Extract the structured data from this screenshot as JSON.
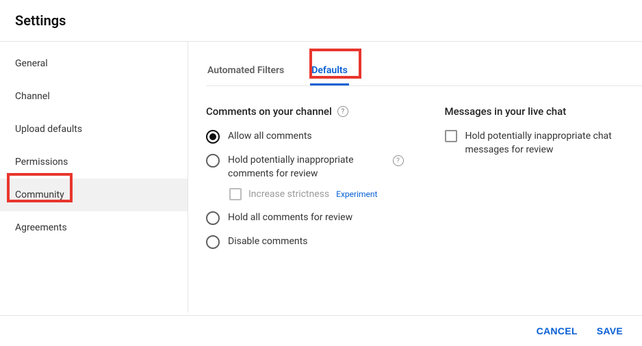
{
  "title": "Settings",
  "sidebar": {
    "items": [
      {
        "label": "General",
        "active": false
      },
      {
        "label": "Channel",
        "active": false
      },
      {
        "label": "Upload defaults",
        "active": false
      },
      {
        "label": "Permissions",
        "active": false
      },
      {
        "label": "Community",
        "active": true
      },
      {
        "label": "Agreements",
        "active": false
      }
    ]
  },
  "tabs": [
    {
      "label": "Automated Filters",
      "active": false
    },
    {
      "label": "Defaults",
      "active": true
    }
  ],
  "comments": {
    "title": "Comments on your channel",
    "options": [
      {
        "label": "Allow all comments",
        "selected": true
      },
      {
        "label": "Hold potentially inappropriate comments for review",
        "selected": false,
        "help": true,
        "sub": {
          "label": "Increase strictness",
          "badge": "Experiment",
          "disabled": true
        }
      },
      {
        "label": "Hold all comments for review",
        "selected": false
      },
      {
        "label": "Disable comments",
        "selected": false
      }
    ]
  },
  "livechat": {
    "title": "Messages in your live chat",
    "options": [
      {
        "label": "Hold potentially inappropriate chat messages for review",
        "checked": false
      }
    ]
  },
  "footer": {
    "cancel": "CANCEL",
    "save": "SAVE"
  }
}
